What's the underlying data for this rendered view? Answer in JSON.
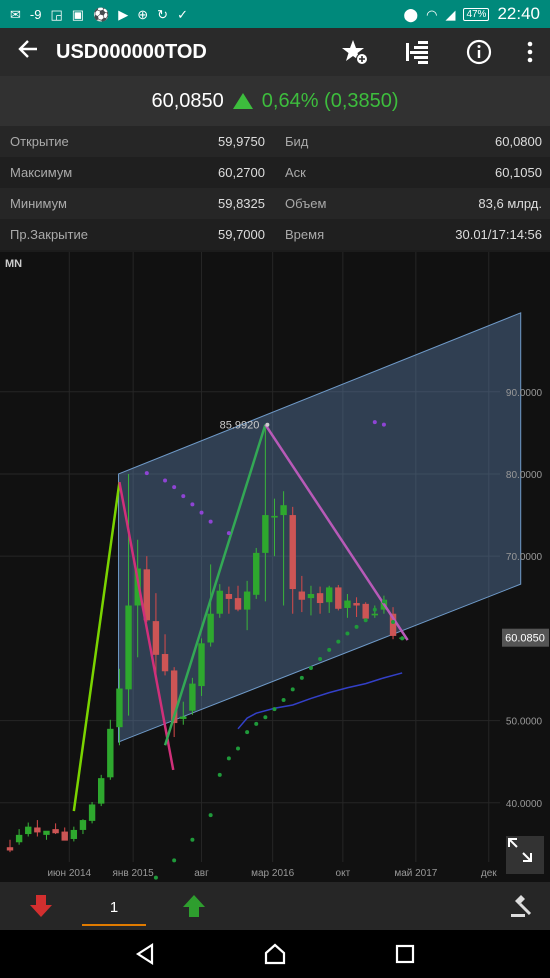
{
  "status_bar": {
    "signal_text": "-9",
    "battery": "47%",
    "time": "22:40"
  },
  "app_bar": {
    "title": "USD000000TOD",
    "icons": [
      "back-arrow-icon",
      "favorite-add-icon",
      "order-book-icon",
      "info-icon",
      "more-vert-icon"
    ]
  },
  "quote": {
    "price": "60,0850",
    "change": "0,64% (0,3850)",
    "direction": "up",
    "color_up": "#3dbd3d"
  },
  "stats": [
    {
      "label": "Открытие",
      "value": "59,9750",
      "label2": "Бид",
      "value2": "60,0800"
    },
    {
      "label": "Максимум",
      "value": "60,2700",
      "label2": "Аск",
      "value2": "60,1050"
    },
    {
      "label": "Минимум",
      "value": "59,8325",
      "label2": "Объем",
      "value2": "83,6 млрд."
    },
    {
      "label": "Пр.Закрытие",
      "value": "59,7000",
      "label2": "Время",
      "value2": "30.01/17:14:56"
    }
  ],
  "chart": {
    "period": "MN",
    "price_labels": [
      "90.0000",
      "80.0000",
      "70.0000",
      "60.0850",
      "50.0000",
      "40.0000"
    ],
    "price_values": [
      90,
      80,
      70,
      60.085,
      50,
      40
    ],
    "current_price": 60.085,
    "date_labels": [
      "июн 2014",
      "янв 2015",
      "авг",
      "мар 2016",
      "окт",
      "май 2017",
      "дек"
    ],
    "peak_label": "85.9920",
    "peak_value": 85.992,
    "y_range": [
      32.8,
      107
    ],
    "candles": [
      {
        "o": 34.6,
        "h": 35.5,
        "l": 34.0,
        "c": 34.2
      },
      {
        "o": 35.2,
        "h": 36.8,
        "l": 34.9,
        "c": 36.1
      },
      {
        "o": 36.2,
        "h": 37.6,
        "l": 35.9,
        "c": 37.1
      },
      {
        "o": 37.0,
        "h": 37.9,
        "l": 35.9,
        "c": 36.4
      },
      {
        "o": 36.1,
        "h": 36.5,
        "l": 35.5,
        "c": 36.6
      },
      {
        "o": 36.8,
        "h": 37.5,
        "l": 36.2,
        "c": 36.3
      },
      {
        "o": 36.5,
        "h": 37.0,
        "l": 35.5,
        "c": 35.4
      },
      {
        "o": 35.6,
        "h": 37.1,
        "l": 35.3,
        "c": 36.7
      },
      {
        "o": 36.7,
        "h": 38.0,
        "l": 36.2,
        "c": 37.9
      },
      {
        "o": 37.8,
        "h": 40.1,
        "l": 37.5,
        "c": 39.8
      },
      {
        "o": 39.9,
        "h": 43.4,
        "l": 39.6,
        "c": 43.0
      },
      {
        "o": 43.1,
        "h": 50.1,
        "l": 42.8,
        "c": 49.0
      },
      {
        "o": 49.2,
        "h": 56.3,
        "l": 47.0,
        "c": 53.9
      },
      {
        "o": 53.8,
        "h": 80.0,
        "l": 50.6,
        "c": 64.0
      },
      {
        "o": 64.0,
        "h": 72.0,
        "l": 57.7,
        "c": 68.5
      },
      {
        "o": 68.4,
        "h": 70.0,
        "l": 62.0,
        "c": 62.2
      },
      {
        "o": 62.1,
        "h": 65.5,
        "l": 55.0,
        "c": 58.0
      },
      {
        "o": 58.1,
        "h": 60.5,
        "l": 55.5,
        "c": 56.0
      },
      {
        "o": 56.1,
        "h": 56.5,
        "l": 48.0,
        "c": 49.7
      },
      {
        "o": 50.2,
        "h": 52.3,
        "l": 49.5,
        "c": 50.5
      },
      {
        "o": 51.2,
        "h": 55.2,
        "l": 50.7,
        "c": 54.5
      },
      {
        "o": 54.2,
        "h": 60.0,
        "l": 53.0,
        "c": 59.4
      },
      {
        "o": 59.5,
        "h": 69.0,
        "l": 59.0,
        "c": 63.0
      },
      {
        "o": 63.0,
        "h": 66.6,
        "l": 62.5,
        "c": 65.8
      },
      {
        "o": 65.4,
        "h": 66.3,
        "l": 63.0,
        "c": 64.8
      },
      {
        "o": 64.9,
        "h": 66.4,
        "l": 63.3,
        "c": 63.5
      },
      {
        "o": 63.5,
        "h": 67.0,
        "l": 61.0,
        "c": 65.7
      },
      {
        "o": 65.3,
        "h": 71.0,
        "l": 64.8,
        "c": 70.4
      },
      {
        "o": 70.4,
        "h": 85.992,
        "l": 64.5,
        "c": 75.0
      },
      {
        "o": 74.7,
        "h": 77.0,
        "l": 70.0,
        "c": 74.9
      },
      {
        "o": 75.0,
        "h": 77.9,
        "l": 64.0,
        "c": 76.2
      },
      {
        "o": 75.0,
        "h": 76.0,
        "l": 63.0,
        "c": 66.0
      },
      {
        "o": 65.7,
        "h": 67.6,
        "l": 63.2,
        "c": 64.7
      },
      {
        "o": 64.9,
        "h": 66.4,
        "l": 62.8,
        "c": 65.4
      },
      {
        "o": 65.5,
        "h": 66.3,
        "l": 63.0,
        "c": 64.3
      },
      {
        "o": 64.4,
        "h": 66.4,
        "l": 63.1,
        "c": 66.2
      },
      {
        "o": 66.2,
        "h": 66.5,
        "l": 63.4,
        "c": 63.6
      },
      {
        "o": 63.7,
        "h": 65.4,
        "l": 62.5,
        "c": 64.6
      },
      {
        "o": 64.3,
        "h": 65.0,
        "l": 62.6,
        "c": 64.0
      },
      {
        "o": 64.2,
        "h": 64.4,
        "l": 62.0,
        "c": 62.4
      },
      {
        "o": 62.8,
        "h": 64.0,
        "l": 62.5,
        "c": 63.0
      },
      {
        "o": 63.5,
        "h": 65.2,
        "l": 63.0,
        "c": 64.7
      },
      {
        "o": 63.0,
        "h": 63.8,
        "l": 59.9,
        "c": 60.3
      },
      {
        "o": 59.98,
        "h": 60.27,
        "l": 59.83,
        "c": 60.085
      }
    ],
    "psar_points": [
      [
        16,
        30.9
      ],
      [
        18,
        33.0
      ],
      [
        20,
        35.5
      ],
      [
        22,
        38.5
      ],
      [
        23,
        43.4
      ],
      [
        24,
        45.4
      ],
      [
        25,
        46.6
      ],
      [
        26,
        48.6
      ],
      [
        27,
        49.6
      ],
      [
        28,
        50.4
      ],
      [
        29,
        51.4
      ],
      [
        30,
        52.5
      ],
      [
        31,
        53.8
      ],
      [
        32,
        55.2
      ],
      [
        33,
        56.4
      ],
      [
        34,
        57.5
      ],
      [
        35,
        58.6
      ],
      [
        36,
        59.6
      ],
      [
        37,
        60.6
      ],
      [
        38,
        61.4
      ],
      [
        39,
        62.2
      ],
      [
        40,
        63.5
      ],
      [
        41,
        64.5
      ],
      [
        42,
        62.0
      ],
      [
        43,
        60.0
      ]
    ],
    "psar_top_points": [
      [
        15,
        80.1
      ],
      [
        17,
        79.2
      ],
      [
        18,
        78.4
      ],
      [
        19,
        77.3
      ],
      [
        20,
        76.3
      ],
      [
        21,
        75.3
      ],
      [
        22,
        74.2
      ],
      [
        24,
        72.8
      ],
      [
        40,
        86.3
      ],
      [
        41,
        86.0
      ]
    ],
    "channel": {
      "upper": [
        [
          11.9,
          80.0
        ],
        [
          56,
          99.6
        ]
      ],
      "lower": [
        [
          11.9,
          47.4
        ],
        [
          56,
          66.6
        ]
      ]
    },
    "trend_lines": [
      [
        [
          7,
          39.0
        ],
        [
          12,
          79.0
        ]
      ],
      [
        [
          12,
          79.0
        ],
        [
          17.9,
          44.0
        ]
      ],
      [
        [
          17,
          47.0
        ],
        [
          28,
          86.0
        ]
      ],
      [
        [
          28,
          86.0
        ],
        [
          43.6,
          59.8
        ]
      ]
    ],
    "ma_line": [
      [
        25,
        49.0
      ],
      [
        26,
        50.3
      ],
      [
        27,
        50.9
      ],
      [
        29,
        51.5
      ],
      [
        31,
        51.9
      ],
      [
        33,
        52.7
      ],
      [
        35,
        53.4
      ],
      [
        37,
        54.0
      ],
      [
        39,
        54.5
      ],
      [
        41,
        55.2
      ],
      [
        43,
        55.8
      ]
    ]
  },
  "bottom_bar": {
    "quantity": "1",
    "colors": {
      "sell": "#d32f2f",
      "buy": "#2e9e2e"
    }
  }
}
